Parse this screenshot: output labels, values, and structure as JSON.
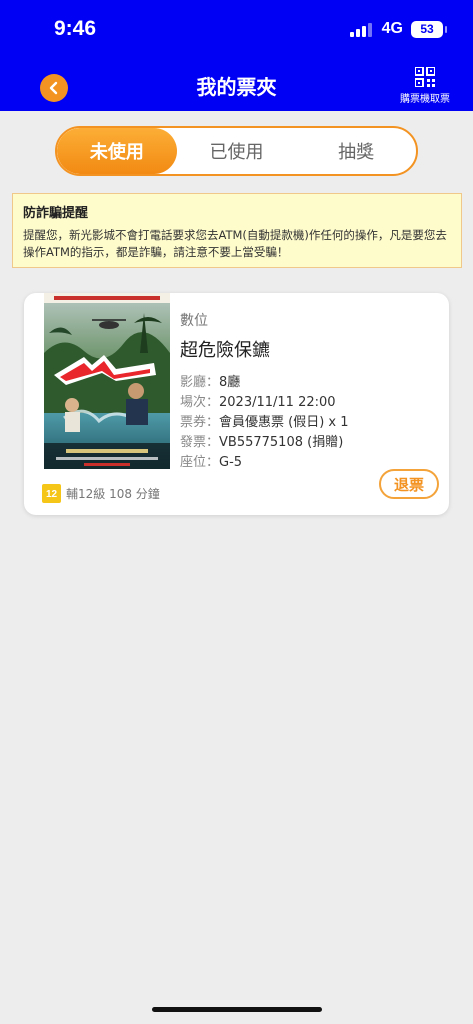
{
  "status": {
    "time": "9:46",
    "network": "4G",
    "battery": "53"
  },
  "header": {
    "title": "我的票夾",
    "qr_label": "購票機取票"
  },
  "tabs": [
    {
      "label": "未使用",
      "active": true
    },
    {
      "label": "已使用",
      "active": false
    },
    {
      "label": "抽獎",
      "active": false
    }
  ],
  "notice": {
    "title": "防詐騙提醒",
    "body": "提醒您，新光影城不會打電話要求您去ATM(自動提款機)作任何的操作，凡是要您去操作ATM的指示，都是詐騙，請注意不要上當受騙！"
  },
  "ticket": {
    "format": "數位",
    "title": "超危險保鑣",
    "rows": [
      {
        "key": "影廳：",
        "value": "8廳"
      },
      {
        "key": "場次：",
        "value": "2023/11/11 22:00"
      },
      {
        "key": "票券：",
        "value": "會員優惠票 (假日) x 1"
      },
      {
        "key": "發票：",
        "value": "VB55775108 (捐贈)"
      },
      {
        "key": "座位：",
        "value": "G-5"
      }
    ],
    "rating_badge": "12",
    "rating_text": "輔12級 108 分鐘",
    "refund_label": "退票",
    "poster_title": "超危險保鑣"
  },
  "colors": {
    "header": "#0000f5",
    "accent": "#f39321",
    "notice_bg": "#fffccc"
  }
}
